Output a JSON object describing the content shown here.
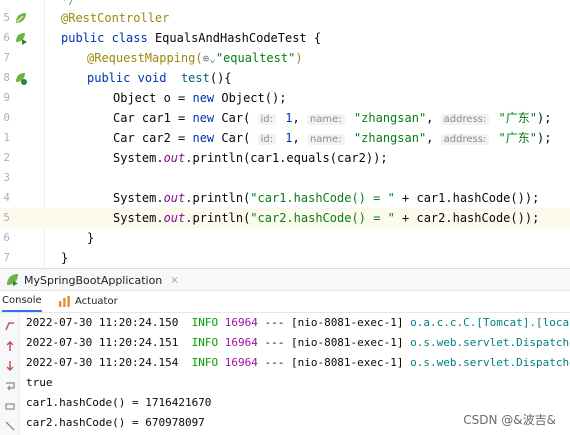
{
  "editor": {
    "lines": [
      {
        "num": "",
        "code_parts": [
          "*/"
        ]
      },
      {
        "num": "5",
        "code_parts": [
          "@RestController"
        ]
      },
      {
        "num": "6",
        "code_parts": [
          "public",
          " ",
          "class",
          " EqualsAndHashCodeTest {"
        ]
      },
      {
        "num": "7",
        "code_parts": [
          "@RequestMapping(",
          "\"equaltest\"",
          ")"
        ]
      },
      {
        "num": "8",
        "code_parts": [
          "public",
          " ",
          "void",
          "  ",
          "test",
          "(){"
        ]
      },
      {
        "num": "9",
        "code_parts": [
          "Object o = ",
          "new",
          " Object();"
        ]
      },
      {
        "num": "0",
        "code_parts": [
          "Car car1 = ",
          "new",
          " Car( ",
          "id:",
          " ",
          "1",
          ", ",
          "name:",
          " ",
          "\"zhangsan\"",
          ", ",
          "address:",
          " ",
          "\"广东\"",
          ");"
        ]
      },
      {
        "num": "1",
        "code_parts": [
          "Car car2 = ",
          "new",
          " Car( ",
          "id:",
          " ",
          "1",
          ", ",
          "name:",
          " ",
          "\"zhangsan\"",
          ", ",
          "address:",
          " ",
          "\"广东\"",
          ");"
        ]
      },
      {
        "num": "2",
        "code_parts": [
          "System.",
          "out",
          ".println(car1.equals(car2));"
        ]
      },
      {
        "num": "3",
        "code_parts": [
          ""
        ]
      },
      {
        "num": "4",
        "code_parts": [
          "System.",
          "out",
          ".println(",
          "\"car1.hashCode() = \"",
          " + car1.hashCode());"
        ]
      },
      {
        "num": "5",
        "code_parts": [
          "System.",
          "out",
          ".println(",
          "\"car2.hashCode() = \"",
          " + car2.hashCode());"
        ]
      },
      {
        "num": "6",
        "code_parts": [
          "}"
        ]
      },
      {
        "num": "7",
        "code_parts": [
          "}"
        ]
      }
    ]
  },
  "run_bar": {
    "tab_label": "MySpringBootApplication",
    "close_glyph": "×"
  },
  "console_tabs": {
    "console_label": "Console",
    "actuator_label": "Actuator"
  },
  "console": {
    "logs": [
      {
        "ts": "2022-07-30 11:20:24.150",
        "level": "INFO",
        "pid": "16964",
        "sep": "---",
        "thread": "[nio-8081-exec-1]",
        "logger": "o.a.c.c.C.[Tomcat].[localhost].[/]"
      },
      {
        "ts": "2022-07-30 11:20:24.151",
        "level": "INFO",
        "pid": "16964",
        "sep": "---",
        "thread": "[nio-8081-exec-1]",
        "logger": "o.s.web.servlet.DispatcherServlet"
      },
      {
        "ts": "2022-07-30 11:20:24.154",
        "level": "INFO",
        "pid": "16964",
        "sep": "---",
        "thread": "[nio-8081-exec-1]",
        "logger": "o.s.web.servlet.DispatcherServlet"
      }
    ],
    "output": [
      "true",
      "car1.hashCode() = 1716421670",
      "car2.hashCode() = 670978097"
    ]
  },
  "watermark": "CSDN @&波吉&",
  "colors": {
    "keyword": "#0033b3",
    "annotation": "#9e880d",
    "string": "#067d17",
    "field": "#871094",
    "info": "#00a000",
    "pid": "#a010a0",
    "logger": "#008080",
    "accent": "#3574f0"
  }
}
